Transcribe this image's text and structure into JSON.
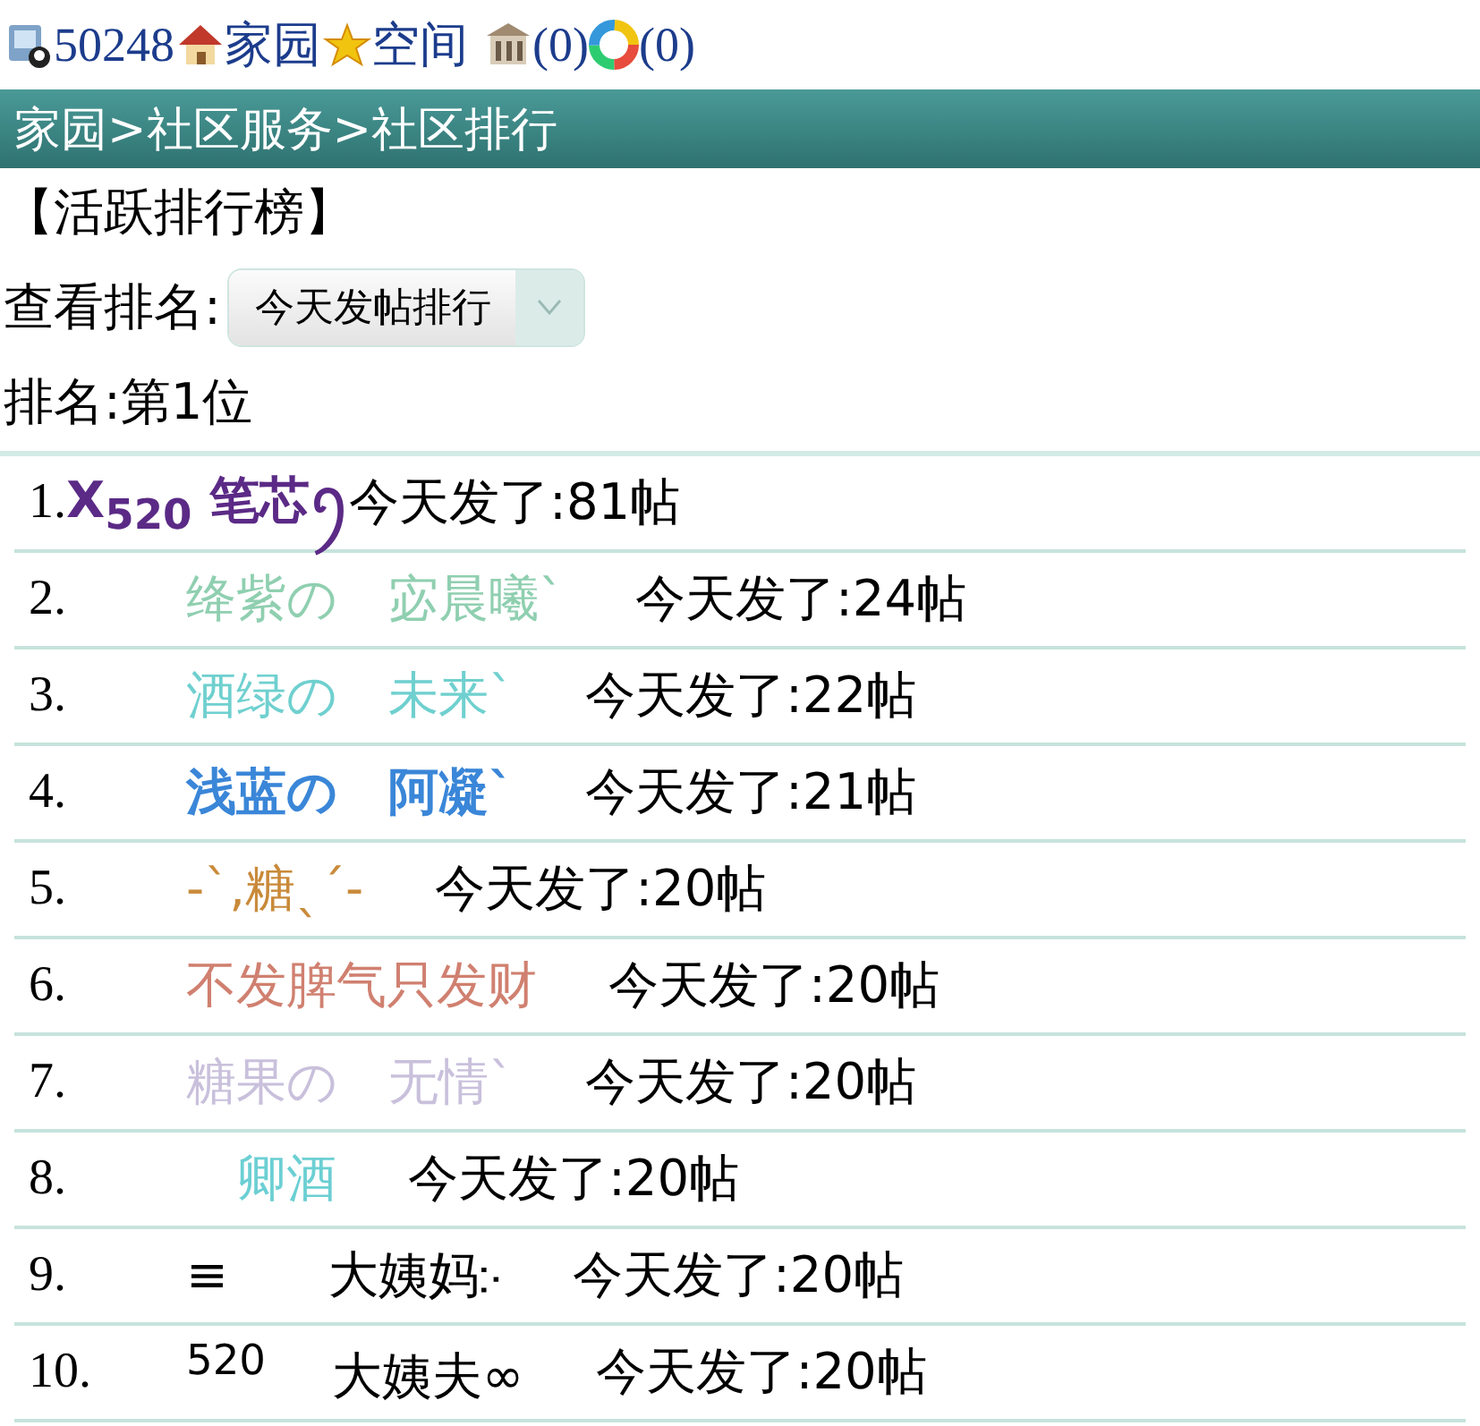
{
  "top_bar": {
    "user_id": "50248",
    "home_link": "家园",
    "space_link": "空间",
    "building_count": "(0)",
    "color_count": "(0)"
  },
  "breadcrumb": "家园>社区服务>社区排行",
  "title": "【活跃排行榜】",
  "view_rank": {
    "label": "查看排名:",
    "value": "今天发帖排行"
  },
  "my_rank": "排名:第1位",
  "rows": [
    {
      "rank": "1.",
      "name": "X$_{520}$ 笔芯ꪆ",
      "count": "今天发了:81帖",
      "color": "#5b2a86"
    },
    {
      "rank": "2.",
      "name": "绛紫の　宓晨曦ˋ",
      "count": "今天发了:24帖",
      "color": "#8fcfb0"
    },
    {
      "rank": "3.",
      "name": "酒绿の　未来ˋ",
      "count": "今天发了:22帖",
      "color": "#6fd0cf"
    },
    {
      "rank": "4.",
      "name": "浅蓝の　阿凝ˋ",
      "count": "今天发了:21帖",
      "color": "#3a86d8"
    },
    {
      "rank": "5.",
      "name": "-ˋ,糖ˎˊ-",
      "count": "今天发了:20帖",
      "color": "#c98a3a"
    },
    {
      "rank": "6.",
      "name": "不发脾气只发财",
      "count": "今天发了:20帖",
      "color": "#d08070"
    },
    {
      "rank": "7.",
      "name": "糖果の　无情ˋ",
      "count": "今天发了:20帖",
      "color": "#c9c0dc"
    },
    {
      "rank": "8.",
      "name": "　卿酒",
      "count": "今天发了:20帖",
      "color": "#6ccfd3"
    },
    {
      "rank": "9.",
      "name": "≡　　大姨妈჻",
      "count": "今天发了:20帖",
      "color": "#000000"
    },
    {
      "rank": "10.",
      "name": "$^{520}$　 大姨夫∞",
      "count": "今天发了:20帖",
      "color": "#000000"
    }
  ]
}
